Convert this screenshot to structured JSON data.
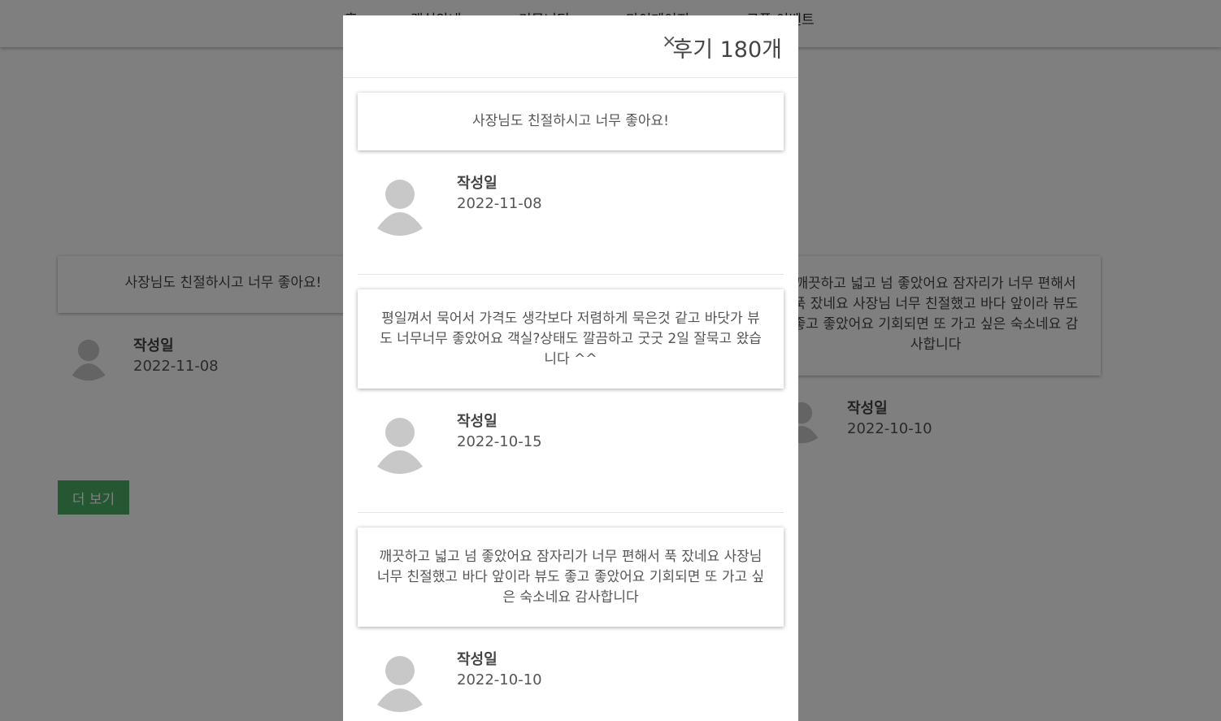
{
  "nav": {
    "items": [
      "홈",
      "객실안내",
      "커뮤니티",
      "마이페이지",
      "쿠폰 이벤트"
    ]
  },
  "background": {
    "reviews": [
      {
        "text": "사장님도 친절하시고 너무 좋아요!",
        "label": "작성일",
        "date": "2022-11-08"
      },
      {
        "text": "깨끗하고 넓고 넘 좋았어요 잠자리가 너무 편해서 푹 잤네요 사장님 너무 친절했고 바다 앞이라 뷰도 좋고 좋았어요 기회되면 또 가고 싶은 숙소네요 감사합니다",
        "label": "작성일",
        "date": "2022-10-10"
      }
    ],
    "more_button": "더 보기"
  },
  "modal": {
    "close_symbol": "×",
    "title": "후기 180개",
    "reviews": [
      {
        "text": "사장님도 친절하시고 너무 좋아요!",
        "label": "작성일",
        "date": "2022-11-08"
      },
      {
        "text": "평일껴서 묵어서 가격도 생각보다 저렴하게 묵은것 같고 바닷가 뷰도 너무너무 좋았어요 객실?상태도 깔끔하고 굿굿 2일 잘묵고 왔습니다 ^^",
        "label": "작성일",
        "date": "2022-10-15"
      },
      {
        "text": "깨끗하고 넓고 넘 좋았어요 잠자리가 너무 편해서 푹 잤네요 사장님 너무 친절했고 바다 앞이라 뷰도 좋고 좋았어요 기회되면 또 가고 싶은 숙소네요 감사합니다",
        "label": "작성일",
        "date": "2022-10-10"
      }
    ]
  },
  "colors": {
    "button_green": "#4caf67",
    "overlay": "rgba(0,0,0,0.5)",
    "avatar_gray": "#c8c8c8"
  }
}
